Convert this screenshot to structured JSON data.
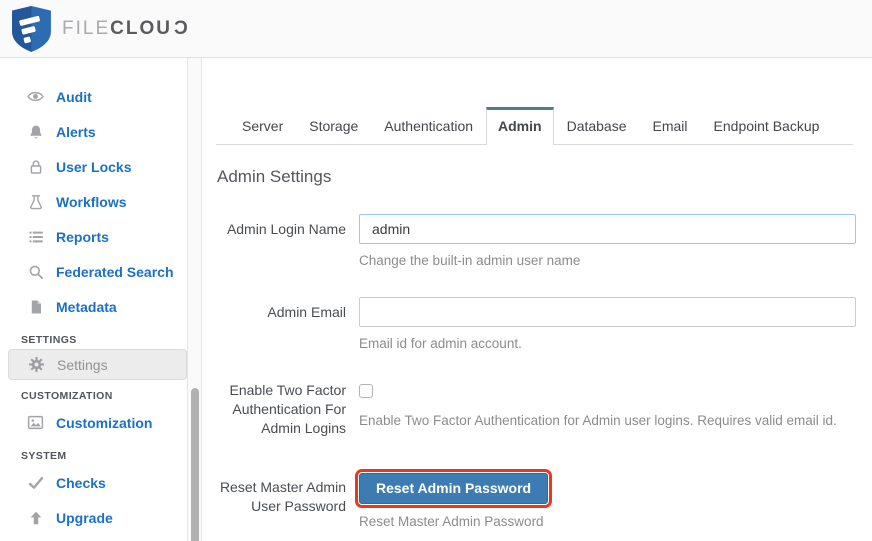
{
  "header": {
    "logo": {
      "brand_file": "FILE",
      "brand_cloud": "CLOU",
      "brand_d": "C",
      "shield_icon": "filecloud-shield-icon",
      "shield_color": "#2d6cb3"
    }
  },
  "sidebar": {
    "items": [
      {
        "label": "Audit",
        "icon": "eye-icon"
      },
      {
        "label": "Alerts",
        "icon": "bell-icon"
      },
      {
        "label": "User Locks",
        "icon": "lock-icon"
      },
      {
        "label": "Workflows",
        "icon": "flask-icon"
      },
      {
        "label": "Reports",
        "icon": "list-icon"
      },
      {
        "label": "Federated Search",
        "icon": "search-icon"
      },
      {
        "label": "Metadata",
        "icon": "file-icon"
      }
    ],
    "sections": [
      {
        "header": "SETTINGS",
        "items": [
          {
            "label": "Settings",
            "icon": "gear-icon",
            "selected": true
          }
        ]
      },
      {
        "header": "CUSTOMIZATION",
        "items": [
          {
            "label": "Customization",
            "icon": "image-icon",
            "selected": false
          }
        ]
      },
      {
        "header": "SYSTEM",
        "items": [
          {
            "label": "Checks",
            "icon": "check-icon",
            "selected": false
          },
          {
            "label": "Upgrade",
            "icon": "arrow-up-icon",
            "selected": false
          }
        ]
      }
    ],
    "link_color": "#1b70c8"
  },
  "tabs": {
    "items": [
      "Server",
      "Storage",
      "Authentication",
      "Admin",
      "Database",
      "Email",
      "Endpoint Backup"
    ],
    "active": "Admin",
    "active_index": 3,
    "active_border_color": "#4e7d8e"
  },
  "main": {
    "title": "Admin Settings",
    "fields": [
      {
        "label": "Admin Login Name",
        "type": "text",
        "value": "admin",
        "help": "Change the built-in admin user name"
      },
      {
        "label": "Admin Email",
        "type": "text",
        "value": "",
        "help": "Email id for admin account."
      },
      {
        "label": "Enable Two Factor Authentication For Admin Logins",
        "type": "checkbox",
        "checked": false,
        "help": "Enable Two Factor Authentication for Admin user logins. Requires valid email id."
      },
      {
        "label": "Reset Master Admin User Password",
        "type": "button",
        "button_label": "Reset Admin Password",
        "help": "Reset Master Admin Password"
      }
    ]
  },
  "annotation": {
    "target": "reset-admin-password-button",
    "color": "#e8391d"
  },
  "colors": {
    "button": "#3d7cb2",
    "focus_input_border": "#96c9ee",
    "selected_item_bg": "#ececec",
    "help_text": "#8c8c8c"
  }
}
